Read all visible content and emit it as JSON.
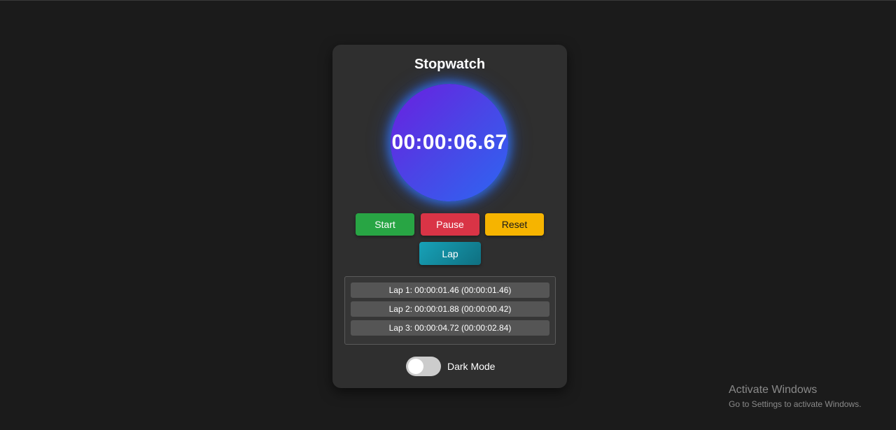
{
  "app": {
    "title": "Stopwatch"
  },
  "timer": {
    "display": "00:00:06.67"
  },
  "controls": {
    "start_label": "Start",
    "pause_label": "Pause",
    "reset_label": "Reset",
    "lap_label": "Lap"
  },
  "laps": [
    {
      "text": "Lap 1: 00:00:01.46 (00:00:01.46)"
    },
    {
      "text": "Lap 2: 00:00:01.88 (00:00:00.42)"
    },
    {
      "text": "Lap 3: 00:00:04.72 (00:00:02.84)"
    }
  ],
  "settings": {
    "dark_mode_label": "Dark Mode",
    "dark_mode_on": false
  },
  "os_watermark": {
    "title": "Activate Windows",
    "subtitle": "Go to Settings to activate Windows."
  },
  "colors": {
    "start": "#28a544",
    "pause": "#d93446",
    "reset": "#f6b400",
    "lap": "#17a2b8",
    "clock_gradient_start": "#6a1fe0",
    "clock_gradient_end": "#2d66f2"
  }
}
